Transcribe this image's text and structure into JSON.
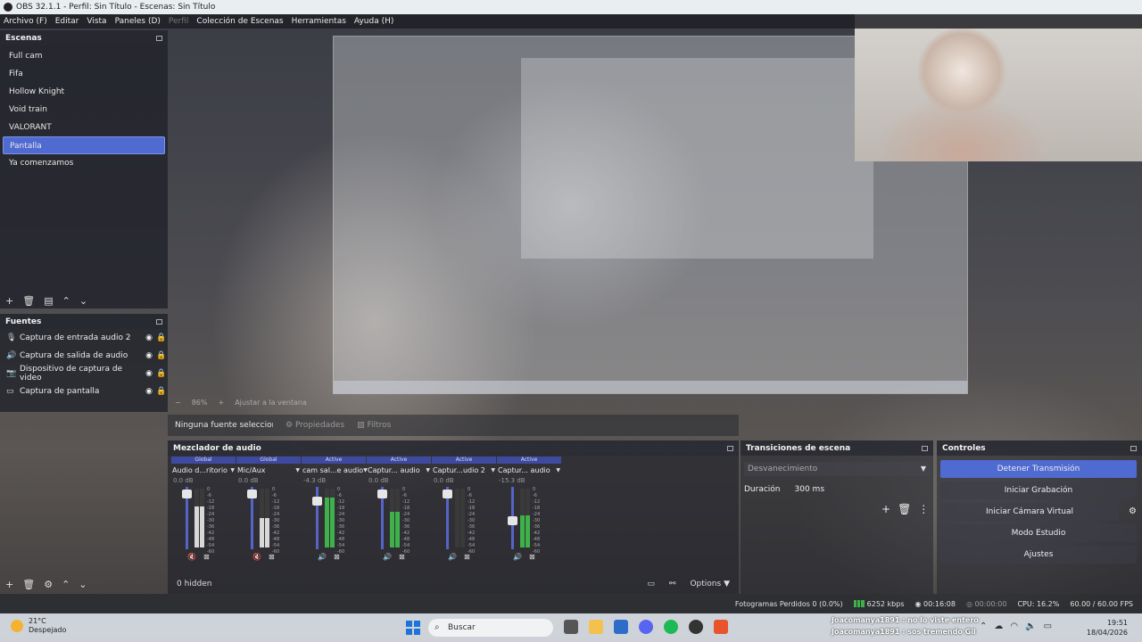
{
  "window": {
    "title": "OBS 32.1.1 - Perfil: Sin Título - Escenas: Sin Título"
  },
  "menu": [
    "Archivo (F)",
    "Editar",
    "Vista",
    "Paneles (D)",
    "Perfil",
    "Colección de Escenas",
    "Herramientas",
    "Ayuda (H)"
  ],
  "scenes": {
    "title": "Escenas",
    "items": [
      "Full cam",
      "Fifa",
      "Hollow Knight",
      "Void train",
      "VALORANT",
      "Pantalla",
      "Ya comenzamos"
    ],
    "selected": "Pantalla"
  },
  "sources": {
    "title": "Fuentes",
    "items": [
      {
        "label": "Captura de entrada audio 2",
        "icon": "microphone-icon"
      },
      {
        "label": "Captura de salida de audio",
        "icon": "speaker-icon"
      },
      {
        "label": "Dispositivo de captura de video",
        "icon": "camera-icon"
      },
      {
        "label": "Captura de pantalla",
        "icon": "monitor-icon"
      }
    ]
  },
  "preview": {
    "zoom": "86%",
    "label": "Ajustar a la ventana"
  },
  "properties_bar": {
    "none_selected": "Ninguna fuente seleccionada",
    "properties": "Propiedades",
    "filters": "Filtros"
  },
  "mixer": {
    "title": "Mezclador de audio",
    "hidden": "0 hidden",
    "options": "Options",
    "channels": [
      {
        "tag": "Global",
        "name": "Audio d...ritorio",
        "db": "0.0 dB",
        "fader": 0.95,
        "level": 0.7,
        "muted": true
      },
      {
        "tag": "Global",
        "name": "Mic/Aux",
        "db": "0.0 dB",
        "fader": 0.95,
        "level": 0.5,
        "muted": true
      },
      {
        "tag": "Active",
        "name": "cam sal...e audio",
        "db": "-4.3 dB",
        "fader": 0.82,
        "level": 0.85,
        "muted": false
      },
      {
        "tag": "Active",
        "name": "Captur... audio",
        "db": "0.0 dB",
        "fader": 0.95,
        "level": 0.6,
        "muted": false
      },
      {
        "tag": "Active",
        "name": "Captur...udio 2",
        "db": "0.0 dB",
        "fader": 0.95,
        "level": 0.0,
        "muted": false
      },
      {
        "tag": "Active",
        "name": "Captur... audio",
        "db": "-15.3 dB",
        "fader": 0.45,
        "level": 0.55,
        "muted": false
      }
    ],
    "ticks": [
      "0",
      "-6",
      "-12",
      "-18",
      "-24",
      "-30",
      "-36",
      "-42",
      "-48",
      "-54",
      "-60"
    ]
  },
  "transitions": {
    "title": "Transiciones de escena",
    "selected": "Desvanecimiento",
    "duration_label": "Duración",
    "duration_value": "300 ms"
  },
  "controls": {
    "title": "Controles",
    "buttons": [
      "Detener Transmisión",
      "Iniciar Grabación",
      "Iniciar Cámara Virtual",
      "Modo Estudio",
      "Ajustes"
    ]
  },
  "status": {
    "dropped": "Fotogramas Perdidos 0 (0.0%)",
    "kbps": "6252 kbps",
    "stream_time": "00:16:08",
    "rec_time": "00:00:00",
    "cpu": "CPU: 16.2%",
    "fps": "60.00 / 60.00 FPS"
  },
  "taskbar": {
    "weather_temp": "21°C",
    "weather_desc": "Despejado",
    "search": "Buscar",
    "chat": [
      {
        "user": "Joacomanya1891",
        "msg": ": no lo viste entero"
      },
      {
        "user": "Joacomanya1891",
        "msg": ": sos tremendo Gil"
      }
    ],
    "time": "19:51",
    "date": "18/04/2026"
  },
  "colors": {
    "accent": "#4f6ad0",
    "meter_green": "#3fb14a",
    "mute_red": "#e04a4a"
  }
}
